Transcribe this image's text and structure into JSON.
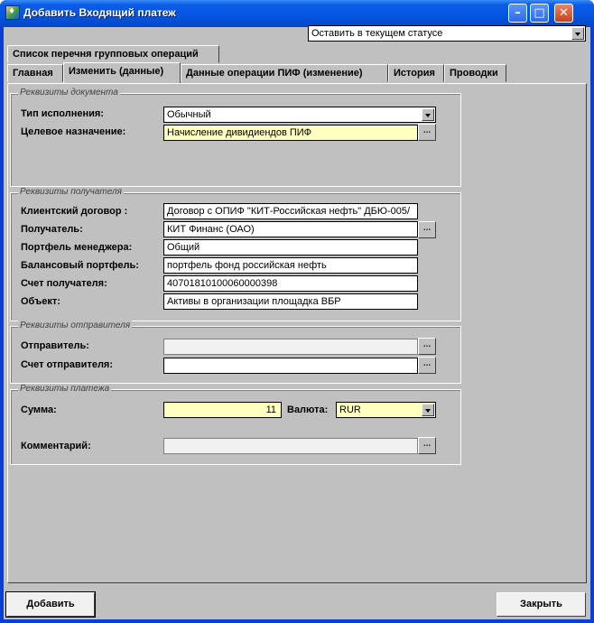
{
  "window": {
    "title": "Добавить Входящий платеж"
  },
  "status_combo": {
    "value": "Оставить в текущем статусе"
  },
  "tabs_row1": [
    "Список перечня групповых операций"
  ],
  "tabs_row2": [
    "Главная",
    "Изменить (данные)",
    "Данные операции ПИФ (изменение)",
    "История",
    "Проводки"
  ],
  "doc_group": {
    "title": "Реквизиты документа",
    "exec_type_label": "Тип исполнения:",
    "exec_type_value": "Обычный",
    "purpose_label": "Целевое назначение:",
    "purpose_value": "Начисление дивидиендов ПИФ"
  },
  "recipient_group": {
    "title": "Реквизиты получателя",
    "contract_label": "Клиентский договор :",
    "contract_value": "Договор с ОПИФ \"КИТ-Российская нефть\" ДБЮ-005/",
    "recipient_label": "Получатель:",
    "recipient_value": "КИТ Финанс (ОАО)",
    "portfolio_mgr_label": "Портфель менеджера:",
    "portfolio_mgr_value": "Общий",
    "balance_portfolio_label": "Балансовый портфель:",
    "balance_portfolio_value": "портфель фонд российская нефть",
    "account_label": "Счет получателя:",
    "account_value": "40701810100060000398",
    "object_label": "Объект:",
    "object_value": "Активы в организации площадка ВБР"
  },
  "sender_group": {
    "title": "Реквизиты отправителя",
    "sender_label": "Отправитель:",
    "sender_value": "",
    "sender_account_label": "Счет отправителя:",
    "sender_account_value": ""
  },
  "payment_group": {
    "title": "Реквизиты платежа",
    "sum_label": "Сумма:",
    "sum_value": "11",
    "currency_label": "Валюта:",
    "currency_value": "RUR",
    "comment_label": "Комментарий:",
    "comment_value": ""
  },
  "buttons": {
    "add": "Добавить",
    "close": "Закрыть",
    "ellipsis": "..."
  },
  "colors": {
    "titlebar": "#0555e0",
    "face": "#c0c0c0",
    "highlight_field": "#ffffc0"
  }
}
